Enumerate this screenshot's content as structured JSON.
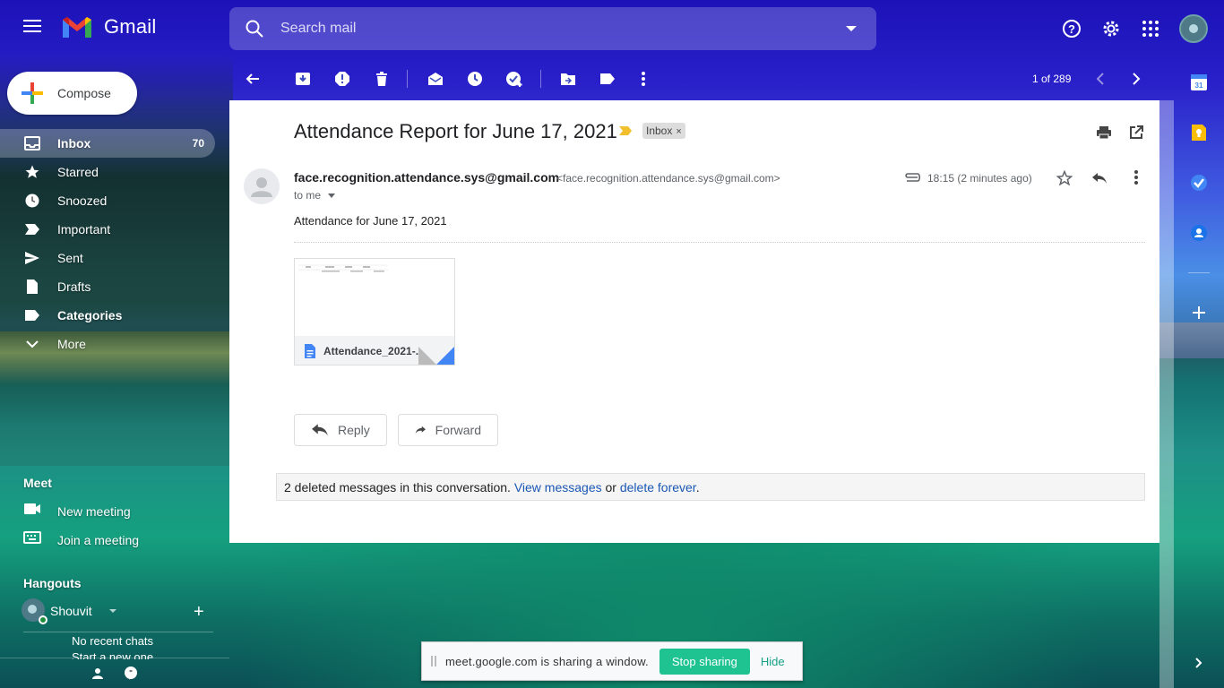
{
  "app": {
    "name": "Gmail"
  },
  "search": {
    "placeholder": "Search mail"
  },
  "compose": {
    "label": "Compose"
  },
  "nav": [
    {
      "label": "Inbox",
      "count": "70",
      "icon": "inbox-icon",
      "active": true
    },
    {
      "label": "Starred",
      "icon": "star-icon"
    },
    {
      "label": "Snoozed",
      "icon": "clock-icon"
    },
    {
      "label": "Important",
      "icon": "important-icon"
    },
    {
      "label": "Sent",
      "icon": "send-icon"
    },
    {
      "label": "Drafts",
      "icon": "draft-icon"
    },
    {
      "label": "Categories",
      "icon": "label-icon",
      "bold": true
    },
    {
      "label": "More",
      "icon": "chevron-down-icon"
    }
  ],
  "meet": {
    "title": "Meet",
    "new_meeting": "New meeting",
    "join_meeting": "Join a meeting"
  },
  "hangouts": {
    "title": "Hangouts",
    "user": "Shouvit",
    "add": "+",
    "no_chats": "No recent chats",
    "start_new": "Start a new one"
  },
  "toolbar": {
    "pager": "1 of 289"
  },
  "email": {
    "subject": "Attendance Report for June 17, 2021",
    "label": "Inbox",
    "label_remove": "×",
    "sender_name": "face.recognition.attendance.sys@gmail.com",
    "sender_email": "<face.recognition.attendance.sys@gmail.com>",
    "to": "to me",
    "timestamp": "18:15 (2 minutes ago)",
    "body": "Attendance for June 17, 2021",
    "attachment": {
      "name": "Attendance_2021-..."
    },
    "reply": "Reply",
    "forward": "Forward",
    "deleted": {
      "prefix": "2 deleted messages in this conversation.",
      "view": "View messages",
      "or": "or",
      "delete": "delete forever",
      "suffix": "."
    }
  },
  "share_bar": {
    "text": "meet.google.com is sharing a window.",
    "stop": "Stop sharing",
    "hide": "Hide"
  },
  "colors": {
    "accent": "#1ec391",
    "link": "#1a57b5",
    "gmail_red": "#ea4335"
  }
}
